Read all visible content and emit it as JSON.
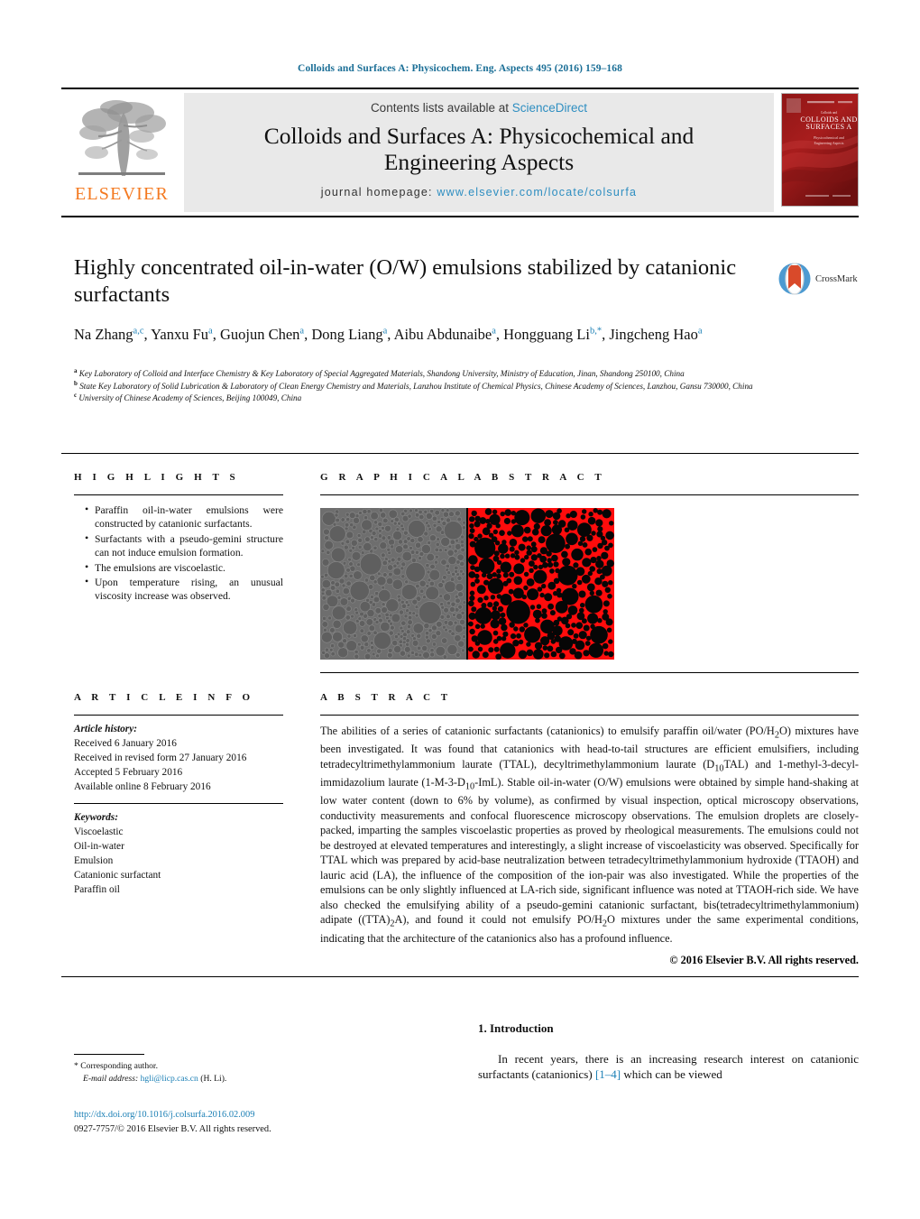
{
  "running_head": "Colloids and Surfaces A: Physicochem. Eng. Aspects 495 (2016) 159–168",
  "masthead": {
    "publisher": "ELSEVIER",
    "contents_prefix": "Contents lists available at ",
    "contents_link": "ScienceDirect",
    "journal_title_line1": "Colloids and Surfaces A: Physicochemical and",
    "journal_title_line2": "Engineering Aspects",
    "homepage_prefix": "journal homepage: ",
    "homepage_url": "www.elsevier.com/locate/colsurfa",
    "cover_line1": "Colloids and",
    "cover_line2": "Surfaces A",
    "cover_sub1": "Physicochemical and",
    "cover_sub2": "Engineering Aspects"
  },
  "title": "Highly concentrated oil-in-water (O/W) emulsions stabilized by catanionic surfactants",
  "authors": [
    {
      "name": "Na Zhang",
      "sup": "a,c",
      "sep": ", "
    },
    {
      "name": "Yanxu Fu",
      "sup": "a",
      "sep": ", "
    },
    {
      "name": "Guojun Chen",
      "sup": "a",
      "sep": ", "
    },
    {
      "name": "Dong Liang",
      "sup": "a",
      "sep": ", "
    },
    {
      "name": "Aibu Abdunaibe",
      "sup": "a",
      "sep": ", "
    },
    {
      "name": "Hongguang Li",
      "sup": "b,*",
      "sep": ", "
    },
    {
      "name": "Jingcheng Hao",
      "sup": "a",
      "sep": ""
    }
  ],
  "affiliations": [
    {
      "mark": "a",
      "text": "Key Laboratory of Colloid and Interface Chemistry & Key Laboratory of Special Aggregated Materials, Shandong University, Ministry of Education, Jinan, Shandong 250100, China"
    },
    {
      "mark": "b",
      "text": "State Key Laboratory of Solid Lubrication & Laboratory of Clean Energy Chemistry and Materials, Lanzhou Institute of Chemical Physics, Chinese Academy of Sciences, Lanzhou, Gansu 730000, China"
    },
    {
      "mark": "c",
      "text": "University of Chinese Academy of Sciences, Beijing 100049, China"
    }
  ],
  "crossmark_label": "CrossMark",
  "highlights": {
    "heading": "H I G H L I G H T S",
    "items": [
      "Paraffin oil-in-water emulsions were constructed by catanionic surfactants.",
      "Surfactants with a pseudo-gemini structure can not induce emulsion formation.",
      "The emulsions are viscoelastic.",
      "Upon temperature rising, an unusual viscosity increase was observed."
    ]
  },
  "graphical_abstract": {
    "heading": "G R A P H I C A L   A B S T R A C T",
    "left_panel": "optical-micrograph-packed-droplets",
    "right_panel": "confocal-fluorescence-micrograph-red"
  },
  "article_info": {
    "heading": "A R T I C L E   I N F O",
    "history_label": "Article history:",
    "history": [
      "Received 6 January 2016",
      "Received in revised form 27 January 2016",
      "Accepted 5 February 2016",
      "Available online 8 February 2016"
    ],
    "keywords_label": "Keywords:",
    "keywords": [
      "Viscoelastic",
      "Oil-in-water",
      "Emulsion",
      "Catanionic surfactant",
      "Paraffin oil"
    ]
  },
  "abstract": {
    "heading": "A B S T R A C T",
    "paragraphs": [
      "The abilities of a series of catanionic surfactants (catanionics) to emulsify paraffin oil/water (PO/H2O) mixtures have been investigated. It was found that catanionics with head-to-tail structures are efficient emulsifiers, including tetradecyltrimethylammonium laurate (TTAL), decyltrimethylammonium laurate (D10TAL) and 1-methyl-3-decyl-immidazolium laurate (1-M-3-D10-ImL). Stable oil-in-water (O/W) emulsions were obtained by simple hand-shaking at low water content (down to 6% by volume), as confirmed by visual inspection, optical microscopy observations, conductivity measurements and confocal fluorescence microscopy observations. The emulsion droplets are closely-packed, imparting the samples viscoelastic properties as proved by rheological measurements. The emulsions could not be destroyed at elevated temperatures and interestingly, a slight increase of viscoelasticity was observed. Specifically for TTAL which was prepared by acid-base neutralization between tetradecyltrimethylammonium hydroxide (TTAOH) and lauric acid (LA), the influence of the composition of the ion-pair was also investigated. While the properties of the emulsions can be only slightly influenced at LA-rich side, significant influence was noted at TTAOH-rich side. We have also checked the emulsifying ability of a pseudo-gemini catanionic surfactant, bis(tetradecyltrimethylammonium) adipate ((TTA)2A), and found it could not emulsify PO/H2O mixtures under the same experimental conditions, indicating that the architecture of the catanionics also has a profound influence."
    ],
    "copyright": "© 2016 Elsevier B.V. All rights reserved."
  },
  "footer": {
    "corresponding_author": "* Corresponding author.",
    "email_label": "E-mail address:",
    "email": "hgli@licp.cas.cn",
    "email_suffix": "(H. Li).",
    "doi": "http://dx.doi.org/10.1016/j.colsurfa.2016.02.009",
    "issn_line": "0927-7757/© 2016 Elsevier B.V. All rights reserved."
  },
  "introduction": {
    "heading": "1. Introduction",
    "text_before_ref": "In recent years, there is an increasing research interest on catanionic surfactants (catanionics) ",
    "reference": "[1–4]",
    "text_after_ref": " which can be viewed"
  },
  "colors": {
    "link": "#1a7fb5",
    "running_head": "#1a6e96",
    "elsevier_orange": "#f47920",
    "band_grey": "#e9e9e9",
    "cover_red": "#9e1b1b",
    "fluorescence_red": "#ff0000"
  }
}
